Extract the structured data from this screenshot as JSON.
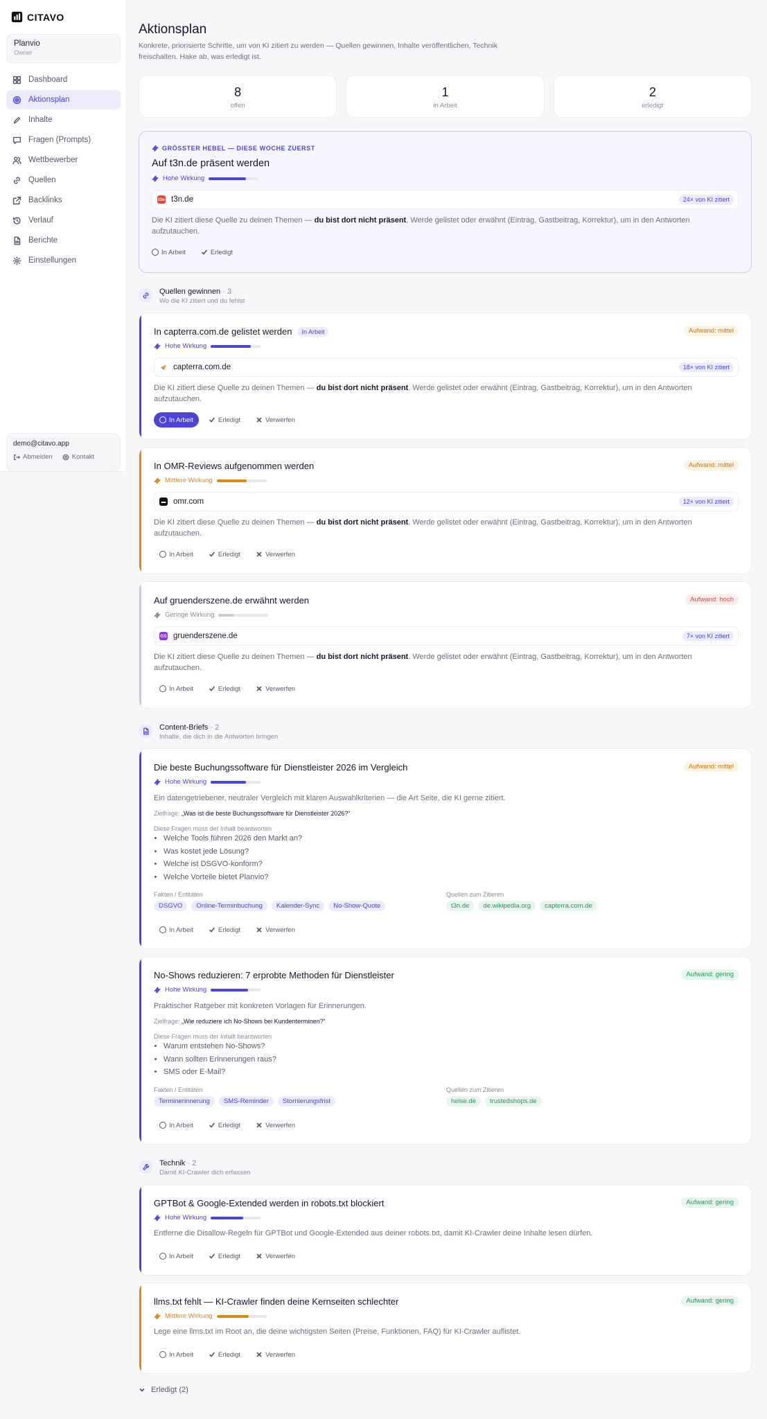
{
  "app": {
    "logo_text": "CITAVO"
  },
  "project": {
    "name": "Planvio",
    "role": "Owner"
  },
  "nav": [
    {
      "label": "Dashboard",
      "icon": "grid-icon"
    },
    {
      "label": "Aktionsplan",
      "icon": "target-icon",
      "active": true
    },
    {
      "label": "Inhalte",
      "icon": "pencil-icon"
    },
    {
      "label": "Fragen (Prompts)",
      "icon": "chat-icon"
    },
    {
      "label": "Wettbewerber",
      "icon": "users-icon"
    },
    {
      "label": "Quellen",
      "icon": "link-icon"
    },
    {
      "label": "Backlinks",
      "icon": "external-link-icon"
    },
    {
      "label": "Verlauf",
      "icon": "history-icon"
    },
    {
      "label": "Berichte",
      "icon": "document-icon"
    },
    {
      "label": "Einstellungen",
      "icon": "gear-icon"
    }
  ],
  "account": {
    "email": "demo@citavo.app",
    "logout": "Abmelden",
    "contact": "Kontakt"
  },
  "page": {
    "title": "Aktionsplan",
    "subtitle": "Konkrete, priorisierte Schritte, um von KI zitiert zu werden — Quellen gewinnen, Inhalte veröffentlichen, Technik freischalten. Hake ab, was erledigt ist."
  },
  "stats": [
    {
      "value": "8",
      "label": "offen"
    },
    {
      "value": "1",
      "label": "in Arbeit"
    },
    {
      "value": "2",
      "label": "erledigt"
    }
  ],
  "labels": {
    "in_progress": "In Arbeit",
    "done": "Erledigt",
    "discard": "Verwerfen",
    "goal_prefix": "Zielfrage:",
    "questions_label": "Diese Fragen muss der Inhalt beantworten",
    "facts_label": "Fakten / Entitäten",
    "sources_label": "Quellen zum Zitieren",
    "done_toggle": "Erledigt (2)"
  },
  "featured": {
    "kicker": "GRÖSSTER HEBEL — DIESE WOCHE ZUERST",
    "title": "Auf t3n.de präsent werden",
    "impact_label": "Hohe Wirkung",
    "impact": 0.75,
    "domain": "t3n.de",
    "cited": "24× von KI zitiert",
    "desc_before": "Die KI zitiert diese Quelle zu deinen Themen — ",
    "desc_bold": "du bist dort nicht präsent",
    "desc_after": ". Werde gelistet oder erwähnt (Eintrag, Gastbeitrag, Korrektur), um in den Antworten aufzutauchen."
  },
  "groups": {
    "quellen": {
      "title": "Quellen gewinnen",
      "count": "· 3",
      "sub": "Wo die KI zitiert und du fehlst"
    },
    "content": {
      "title": "Content-Briefs",
      "count": "· 2",
      "sub": "Inhalte, die dich in die Antworten bringen"
    },
    "technik": {
      "title": "Technik",
      "count": "· 2",
      "sub": "Damit KI-Crawler dich erfassen"
    }
  },
  "sources": [
    {
      "title": "In capterra.com.de gelistet werden",
      "status": "In Arbeit",
      "effort": "Aufwand: mittel",
      "impact_label": "Hohe Wirkung",
      "impact": 0.8,
      "domain": "capterra.com.de",
      "cited": "18× von KI zitiert",
      "color": "#4b44d6"
    },
    {
      "title": "In OMR-Reviews aufgenommen werden",
      "effort": "Aufwand: mittel",
      "impact_label": "Mittlere Wirkung",
      "impact": 0.6,
      "domain": "omr.com",
      "cited": "12× von KI zitiert",
      "color": "#d98a12"
    },
    {
      "title": "Auf gruenderszene.de erwähnt werden",
      "effort": "Aufwand: hoch",
      "impact_label": "Geringe Wirkung",
      "impact": 0.3,
      "domain": "gruenderszene.de",
      "cited": "7× von KI zitiert",
      "color": "#c9cad3"
    }
  ],
  "source_desc": {
    "before": "Die KI zitiert diese Quelle zu deinen Themen — ",
    "bold": "du bist dort nicht präsent",
    "after": ". Werde gelistet oder erwähnt (Eintrag, Gastbeitrag, Korrektur), um in den Antworten aufzutauchen."
  },
  "briefs": [
    {
      "title": "Die beste Buchungssoftware für Dienstleister 2026 im Vergleich",
      "effort": "Aufwand: mittel",
      "impact_label": "Hohe Wirkung",
      "impact": 0.7,
      "desc": "Ein datengetriebener, neutraler Vergleich mit klaren Auswahlkriterien — die Art Seite, die KI gerne zitiert.",
      "goal": "„Was ist die beste Buchungssoftware für Dienstleister 2026?“",
      "questions": [
        "Welche Tools führen 2026 den Markt an?",
        "Was kostet jede Lösung?",
        "Welche ist DSGVO-konform?",
        "Welche Vorteile bietet Planvio?"
      ],
      "facts": [
        "DSGVO",
        "Online-Terminbuchung",
        "Kalender-Sync",
        "No-Show-Quote"
      ],
      "cite": [
        "t3n.de",
        "de.wikipedia.org",
        "capterra.com.de"
      ]
    },
    {
      "title": "No-Shows reduzieren: 7 erprobte Methoden für Dienstleister",
      "effort": "Aufwand: gering",
      "impact_label": "Hohe Wirkung",
      "impact": 0.75,
      "desc": "Praktischer Ratgeber mit konkreten Vorlagen für Erinnerungen.",
      "goal": "„Wie reduziere ich No-Shows bei Kundenterminen?“",
      "questions": [
        "Warum entstehen No-Shows?",
        "Wann sollten Erinnerungen raus?",
        "SMS oder E-Mail?"
      ],
      "facts": [
        "Terminerinnerung",
        "SMS-Reminder",
        "Stornierungsfrist"
      ],
      "cite": [
        "heise.de",
        "trustedshops.de"
      ]
    }
  ],
  "tech": [
    {
      "title": "GPTBot & Google-Extended werden in robots.txt blockiert",
      "effort": "Aufwand: gering",
      "impact_label": "Hohe Wirkung",
      "impact": 0.65,
      "desc": "Entferne die Disallow-Regeln für GPTBot und Google-Extended aus deiner robots.txt, damit KI-Crawler deine Inhalte lesen dürfen."
    },
    {
      "title": "llms.txt fehlt — KI-Crawler finden deine Kernseiten schlechter",
      "effort": "Aufwand: gering",
      "impact_label": "Mittlere Wirkung",
      "impact": 0.65,
      "desc": "Lege eine llms.txt im Root an, die deine wichtigsten Seiten (Preise, Funktionen, FAQ) für KI-Crawler auflistet."
    }
  ]
}
